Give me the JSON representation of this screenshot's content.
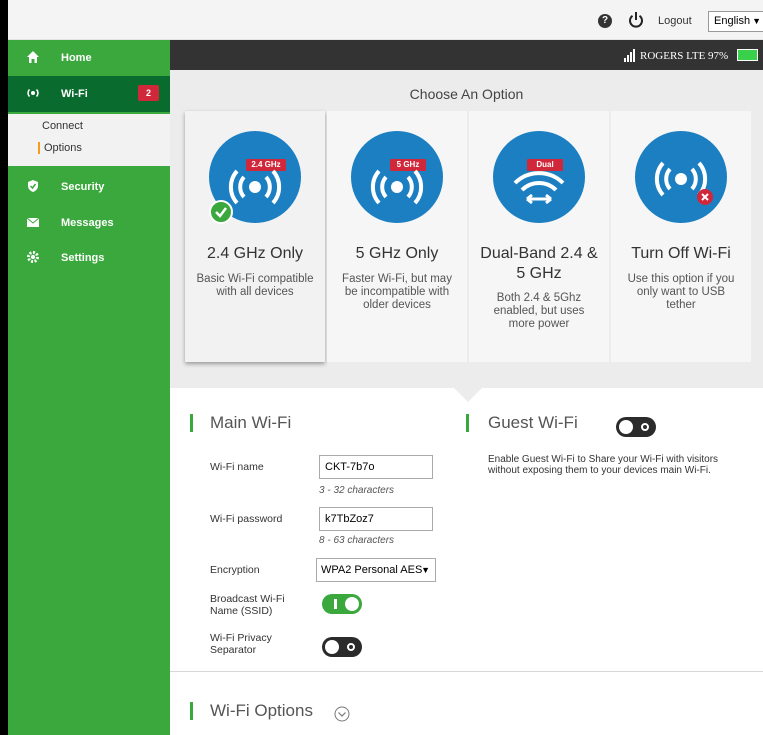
{
  "topbar": {
    "help_icon": "help-icon",
    "power_icon": "power-icon",
    "logout_label": "Logout",
    "language_value": "English"
  },
  "sidebar": {
    "items": [
      {
        "label": "Home",
        "icon": "home-icon"
      },
      {
        "label": "Wi-Fi",
        "icon": "wifi-icon",
        "badge": "2"
      },
      {
        "label": "Security",
        "icon": "shield-icon"
      },
      {
        "label": "Messages",
        "icon": "envelope-icon"
      },
      {
        "label": "Settings",
        "icon": "gear-icon"
      }
    ],
    "subitems": [
      {
        "label": "Connect"
      },
      {
        "label": "Options"
      }
    ]
  },
  "status": {
    "carrier": "ROGERS LTE 97%",
    "signal_icon": "signal-icon",
    "battery_icon": "battery-icon"
  },
  "options": {
    "title": "Choose An Option",
    "cards": [
      {
        "tag": "2.4 GHz",
        "title": "2.4 GHz Only",
        "desc": "Basic Wi-Fi compatible with all devices",
        "selected": true
      },
      {
        "tag": "5 GHz",
        "title": "5 GHz Only",
        "desc": "Faster Wi-Fi, but may be incompatible with older devices"
      },
      {
        "tag": "Dual",
        "title": "Dual-Band 2.4 & 5 GHz",
        "desc": "Both 2.4 & 5Ghz enabled, but uses more power"
      },
      {
        "title": "Turn Off Wi-Fi",
        "desc": "Use this option if you only want to USB tether"
      }
    ]
  },
  "main_wifi": {
    "title": "Main Wi-Fi",
    "name_label": "Wi-Fi name",
    "name_value": "CKT-7b7o",
    "name_hint": "3 - 32 characters",
    "password_label": "Wi-Fi password",
    "password_value": "k7TbZoz7",
    "password_hint": "8 - 63 characters",
    "encryption_label": "Encryption",
    "encryption_value": "WPA2 Personal AES",
    "broadcast_label": "Broadcast Wi-Fi Name (SSID)",
    "privacy_label": "Wi-Fi Privacy Separator"
  },
  "guest_wifi": {
    "title": "Guest Wi-Fi",
    "desc": "Enable Guest Wi-Fi to Share your Wi-Fi with visitors without exposing them to your devices main Wi-Fi."
  },
  "wifi_options": {
    "title": "Wi-Fi Options"
  },
  "colors": {
    "accent_green": "#3aa83c",
    "sidebar_active": "#0a6b2e",
    "circle_blue": "#1b7fc2",
    "tag_red": "#d1273a"
  }
}
